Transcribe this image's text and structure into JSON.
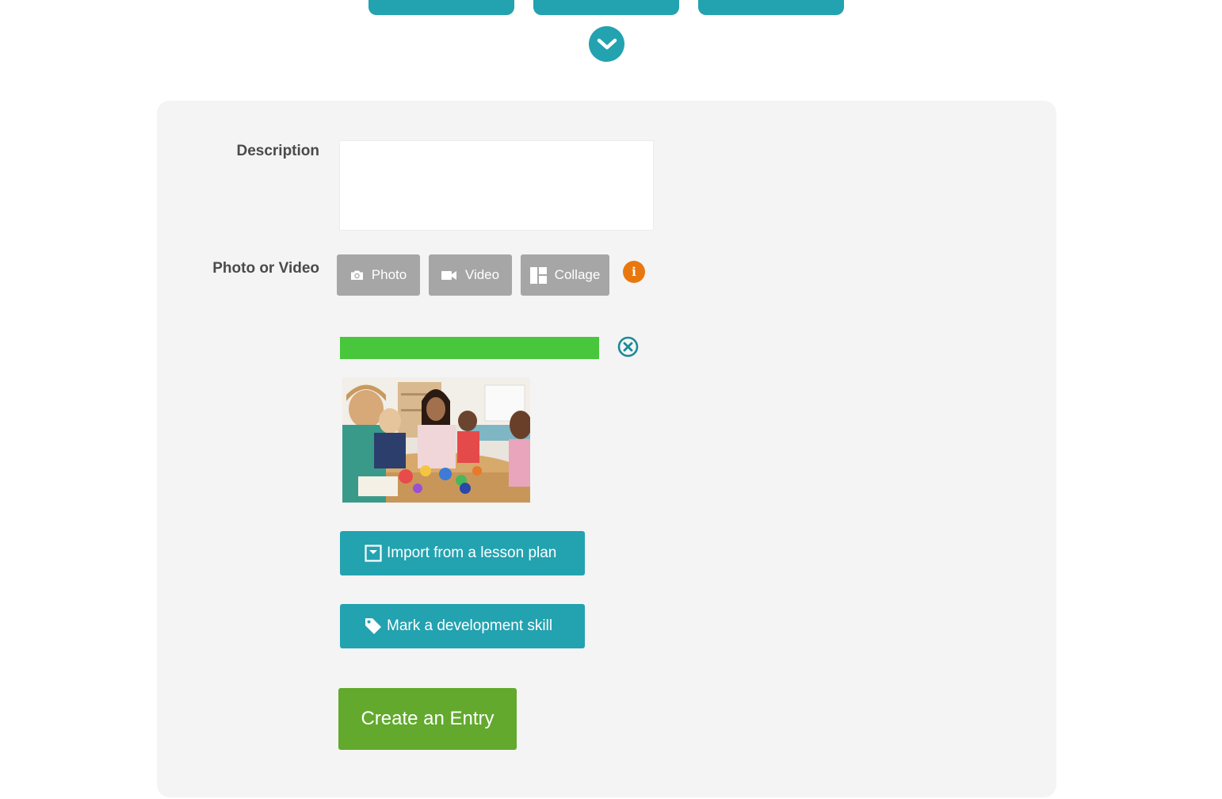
{
  "top_tabs": [
    {
      "label": ""
    },
    {
      "label": ""
    },
    {
      "label": ""
    }
  ],
  "form": {
    "description": {
      "label": "Description",
      "value": "",
      "placeholder": ""
    },
    "media": {
      "label": "Photo or Video",
      "buttons": [
        {
          "label": "Photo",
          "icon": "camera-icon"
        },
        {
          "label": "Video",
          "icon": "video-camera-icon"
        },
        {
          "label": "Collage",
          "icon": "collage-icon"
        }
      ],
      "info_icon": "info-icon",
      "info_glyph": "i"
    },
    "upload": {
      "progress": 1.0,
      "cancel_icon": "close-circle-icon"
    },
    "import_button": {
      "label": "Import from a lesson plan",
      "icon": "import-box-icon"
    },
    "skill_button": {
      "label": "Mark a development skill",
      "icon": "tag-icon"
    },
    "submit_button": {
      "label": "Create an Entry"
    }
  },
  "colors": {
    "accent": "#23a2b0",
    "media_button": "#a6a6a6",
    "info": "#e8780e",
    "progress": "#48c63c",
    "submit": "#62a92d",
    "panel": "#f4f4f4"
  }
}
